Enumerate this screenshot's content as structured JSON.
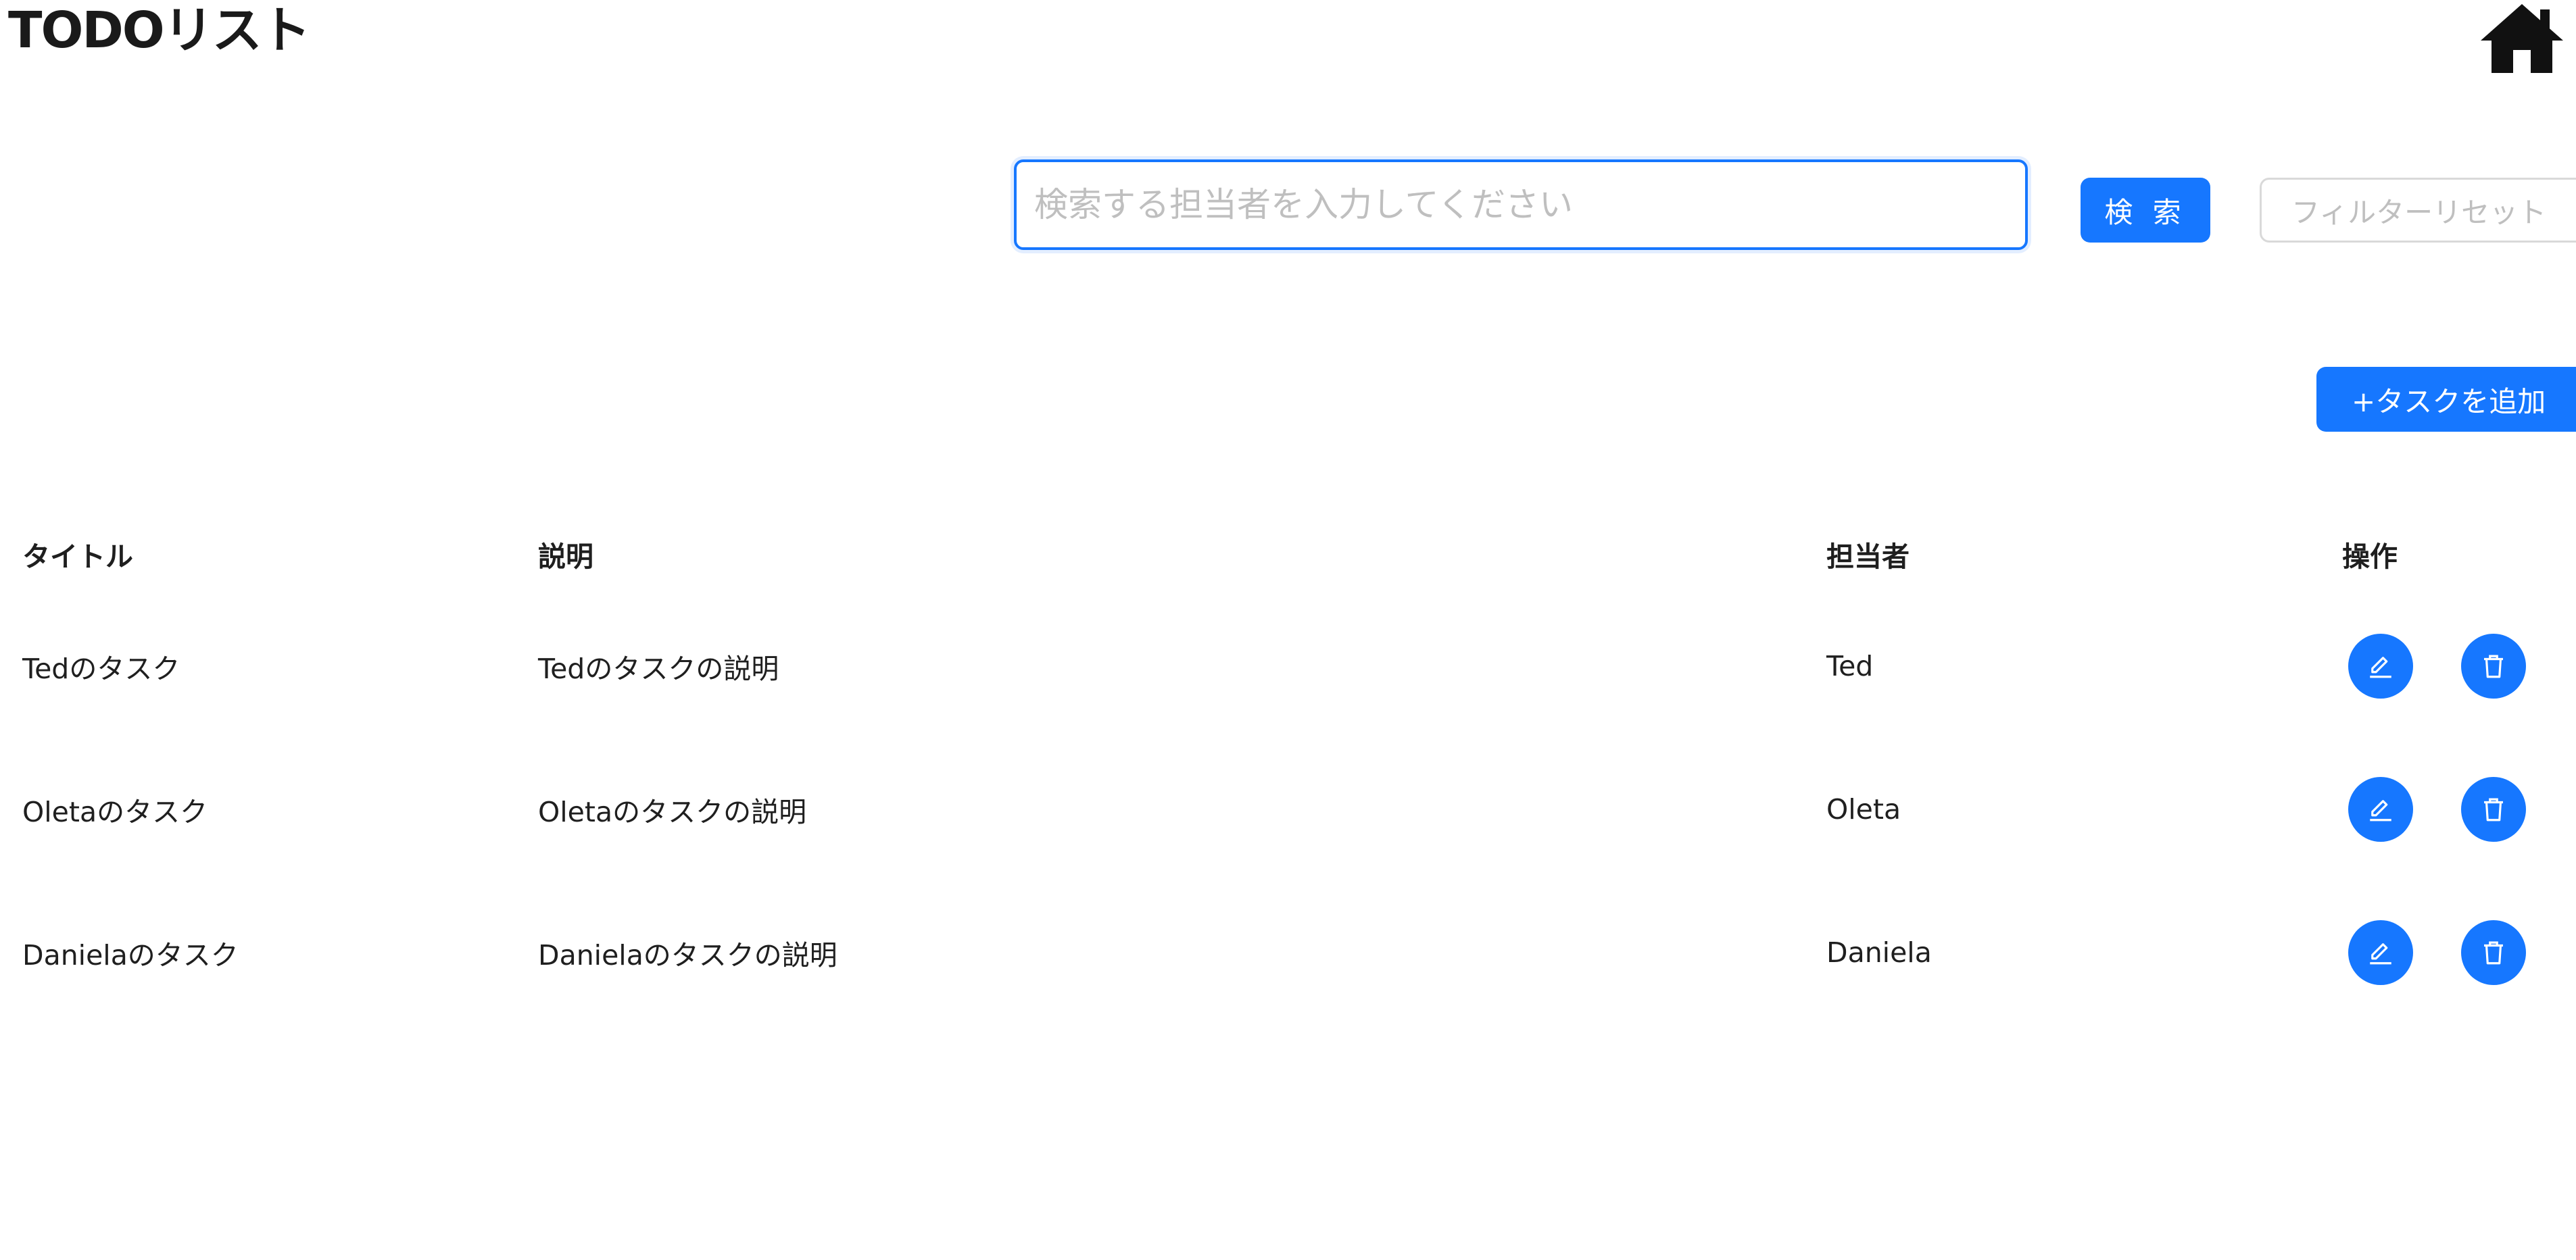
{
  "header": {
    "title": "TODOリスト",
    "home_icon": "home-icon"
  },
  "search": {
    "placeholder": "検索する担当者を入力してください",
    "value": "",
    "search_label": "検 索",
    "reset_label": "フィルターリセット"
  },
  "toolbar": {
    "add_label": "+タスクを追加"
  },
  "table": {
    "columns": [
      "タイトル",
      "説明",
      "担当者",
      "操作"
    ],
    "rows": [
      {
        "title": "Tedのタスク",
        "description": "Tedのタスクの説明",
        "assignee": "Ted"
      },
      {
        "title": "Oletaのタスク",
        "description": "Oletaのタスクの説明",
        "assignee": "Oleta"
      },
      {
        "title": "Danielaのタスク",
        "description": "Danielaのタスクの説明",
        "assignee": "Daniela"
      }
    ],
    "action_icons": [
      "edit-icon",
      "delete-icon"
    ]
  },
  "colors": {
    "primary": "#1677ff",
    "text": "#1f1f1f",
    "placeholder": "#bfbfbf",
    "disabled_border": "#d9d9d9"
  }
}
